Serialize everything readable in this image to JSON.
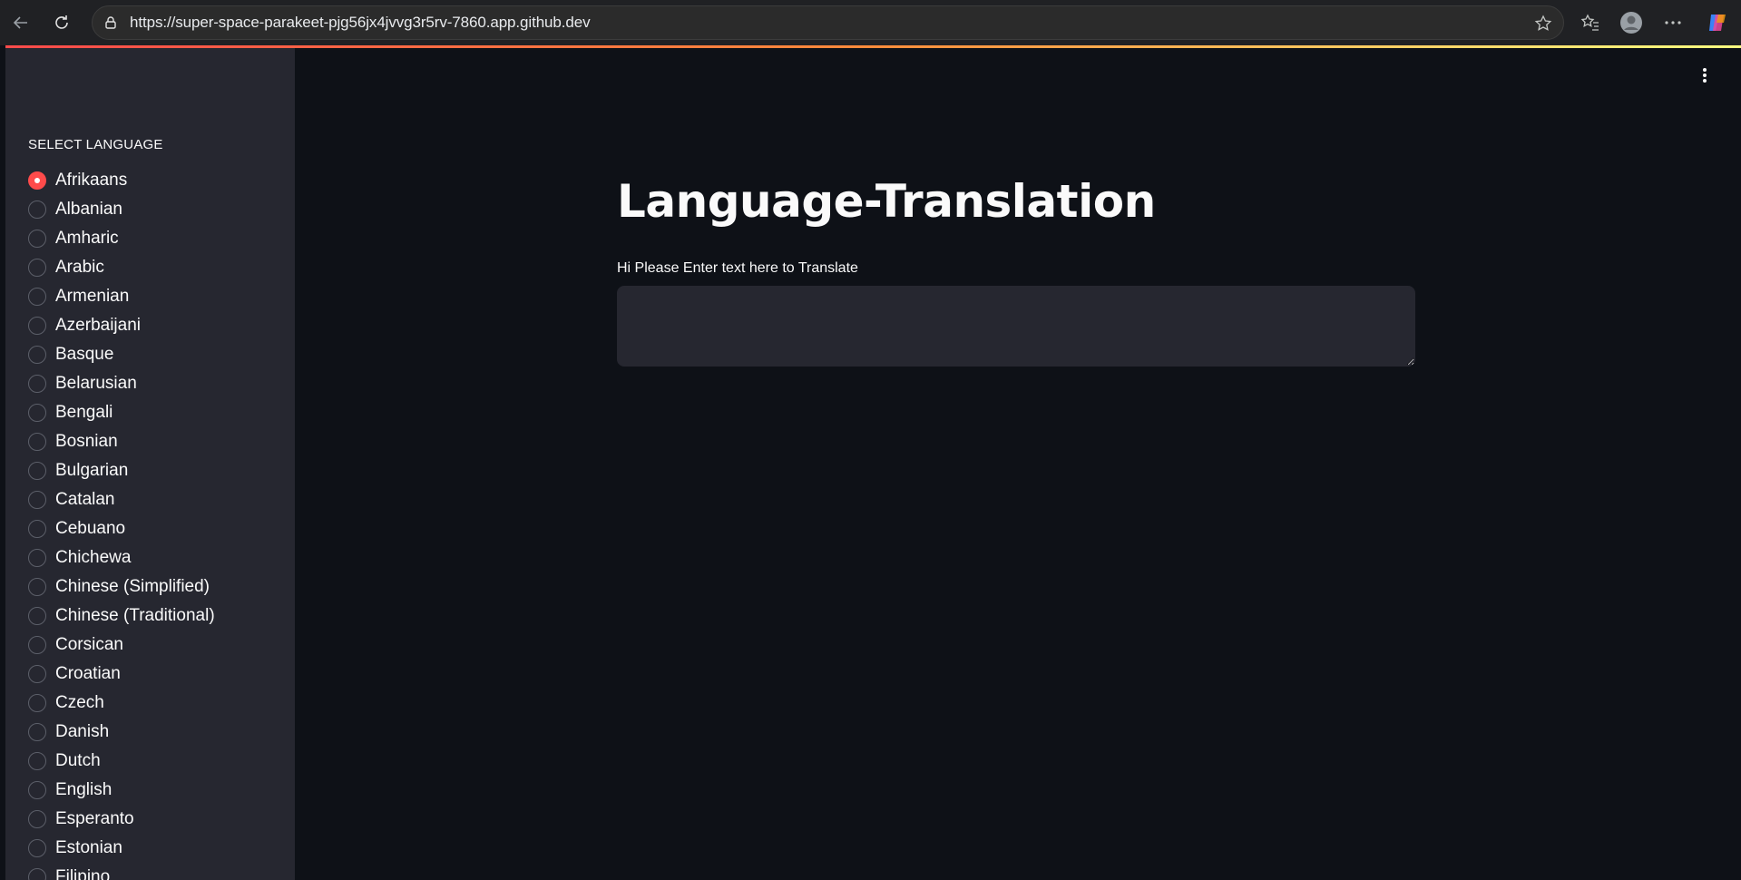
{
  "browser": {
    "url": "https://super-space-parakeet-pjg56jx4jvvg3r5rv-7860.app.github.dev",
    "icons": [
      "back-arrow-icon",
      "reload-icon",
      "lock-icon",
      "star-icon",
      "favorites-icon",
      "profile-icon",
      "more-icon",
      "copilot-icon"
    ]
  },
  "accent_gradient": [
    "#ff4b4b",
    "#fffd80"
  ],
  "sidebar": {
    "heading": "SELECT LANGUAGE",
    "selected": "Afrikaans",
    "languages": [
      "Afrikaans",
      "Albanian",
      "Amharic",
      "Arabic",
      "Armenian",
      "Azerbaijani",
      "Basque",
      "Belarusian",
      "Bengali",
      "Bosnian",
      "Bulgarian",
      "Catalan",
      "Cebuano",
      "Chichewa",
      "Chinese (Simplified)",
      "Chinese (Traditional)",
      "Corsican",
      "Croatian",
      "Czech",
      "Danish",
      "Dutch",
      "English",
      "Esperanto",
      "Estonian",
      "Filipino"
    ]
  },
  "main": {
    "title": "Language-Translation",
    "input_label": "Hi Please Enter text here to Translate",
    "input_value": ""
  },
  "colors": {
    "app_background": "#0e1117",
    "sidebar_background": "#262730",
    "primary": "#ff4b4b",
    "text": "#fafafa"
  }
}
